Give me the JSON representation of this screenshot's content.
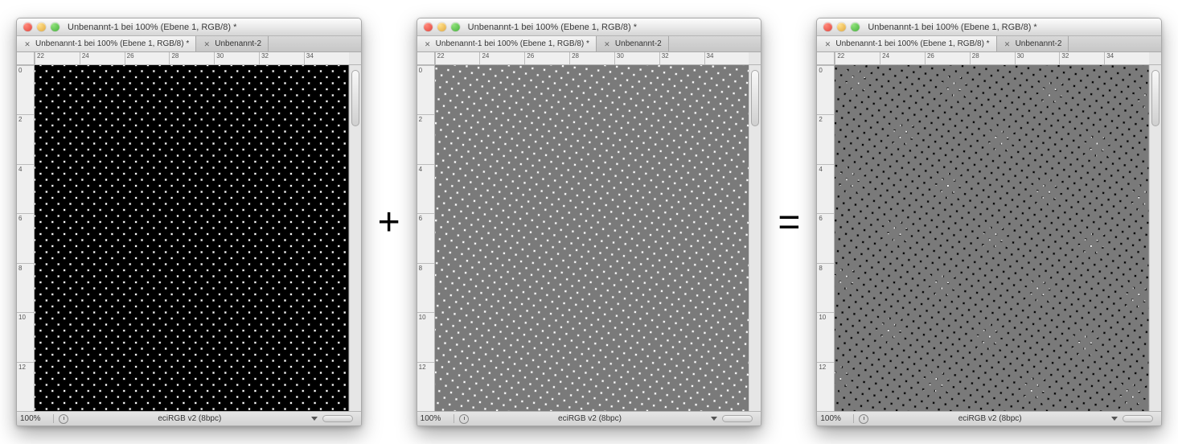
{
  "operators": {
    "plus": "+",
    "equals": "="
  },
  "windows": [
    {
      "title": "Unbenannt-1 bei 100% (Ebene 1, RGB/8) *",
      "tabs": [
        {
          "label": "Unbenannt-1 bei 100% (Ebene 1, RGB/8) *",
          "active": true
        },
        {
          "label": "Unbenannt-2",
          "active": false
        }
      ],
      "ruler_h": [
        "22",
        "24",
        "26",
        "28",
        "30",
        "32",
        "34"
      ],
      "ruler_v": [
        "0",
        "2",
        "4",
        "6",
        "8",
        "10",
        "12"
      ],
      "zoom": "100%",
      "color_profile": "eciRGB v2 (8bpc)",
      "pattern": {
        "dot_color": "#000000",
        "rotation_deg": 0,
        "cell": 15.0,
        "radius": 6.4,
        "extra_layer": null
      }
    },
    {
      "title": "Unbenannt-1 bei 100% (Ebene 1, RGB/8) *",
      "tabs": [
        {
          "label": "Unbenannt-1 bei 100% (Ebene 1, RGB/8) *",
          "active": true
        },
        {
          "label": "Unbenannt-2",
          "active": false
        }
      ],
      "ruler_h": [
        "22",
        "24",
        "26",
        "28",
        "30",
        "32",
        "34"
      ],
      "ruler_v": [
        "0",
        "2",
        "4",
        "6",
        "8",
        "10",
        "12"
      ],
      "zoom": "100%",
      "color_profile": "eciRGB v2 (8bpc)",
      "pattern": {
        "dot_color": "#7a7a7a",
        "rotation_deg": 7,
        "cell": 15.0,
        "radius": 6.4,
        "extra_layer": null
      }
    },
    {
      "title": "Unbenannt-1 bei 100% (Ebene 1, RGB/8) *",
      "tabs": [
        {
          "label": "Unbenannt-1 bei 100% (Ebene 1, RGB/8) *",
          "active": true
        },
        {
          "label": "Unbenannt-2",
          "active": false
        }
      ],
      "ruler_h": [
        "22",
        "24",
        "26",
        "28",
        "30",
        "32",
        "34"
      ],
      "ruler_v": [
        "0",
        "2",
        "4",
        "6",
        "8",
        "10",
        "12"
      ],
      "zoom": "100%",
      "color_profile": "eciRGB v2 (8bpc)",
      "pattern": {
        "dot_color": "#000000",
        "rotation_deg": 0,
        "cell": 15.0,
        "radius": 6.4,
        "extra_layer": {
          "dot_color": "#7a7a7a",
          "rotation_deg": 7,
          "cell": 15.0,
          "radius": 6.4
        }
      }
    }
  ]
}
